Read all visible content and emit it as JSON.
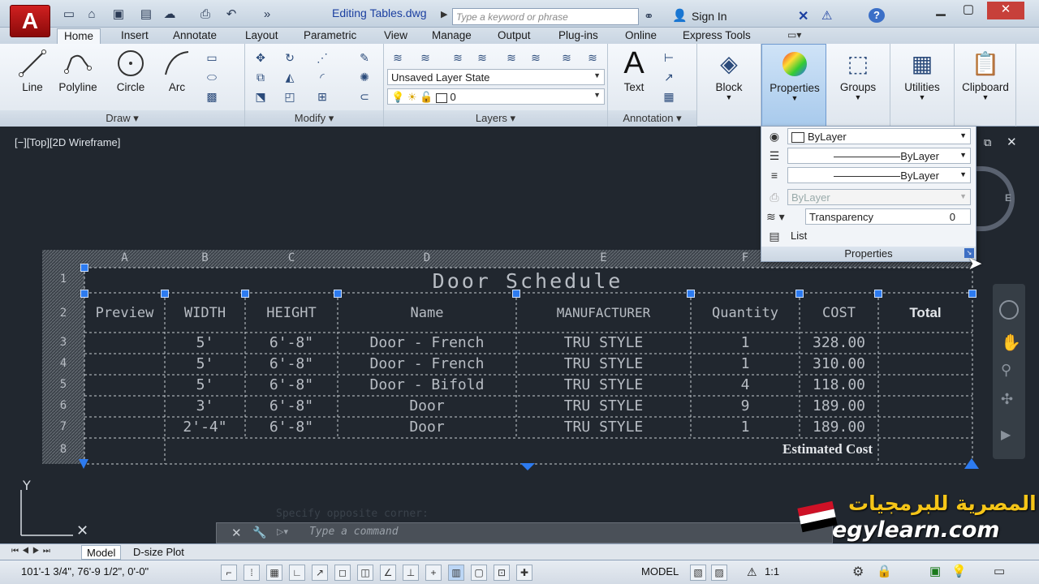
{
  "title_bar": {
    "app_logo": "A",
    "document_title": "Editing Tables.dwg",
    "search_placeholder": "Type a keyword or phrase",
    "sign_in": "Sign In",
    "help": "?"
  },
  "tabs": [
    "Home",
    "Insert",
    "Annotate",
    "Layout",
    "Parametric",
    "View",
    "Manage",
    "Output",
    "Plug-ins",
    "Online",
    "Express Tools"
  ],
  "active_tab": "Home",
  "ribbon": {
    "draw": {
      "title": "Draw",
      "tools": [
        "Line",
        "Polyline",
        "Circle",
        "Arc"
      ]
    },
    "modify": {
      "title": "Modify"
    },
    "layers": {
      "title": "Layers",
      "layer_state": "Unsaved Layer State",
      "current_layer": "0"
    },
    "annotation": {
      "title": "Annotation",
      "text": "Text"
    },
    "big_tools": [
      "Block",
      "Properties",
      "Groups",
      "Utilities",
      "Clipboard"
    ]
  },
  "properties_flyout": {
    "color": "ByLayer",
    "linetype": "ByLayer",
    "lineweight": "ByLayer",
    "plot_style": "ByLayer",
    "transparency_label": "Transparency",
    "transparency_value": "0",
    "list": "List",
    "title": "Properties"
  },
  "viewport_label": "[−][Top][2D Wireframe]",
  "table": {
    "column_letters": [
      "A",
      "B",
      "C",
      "D",
      "E",
      "F"
    ],
    "row_numbers": [
      "1",
      "2",
      "3",
      "4",
      "5",
      "6",
      "7",
      "8"
    ],
    "title": "Door Schedule",
    "headers": [
      "Preview",
      "WIDTH",
      "HEIGHT",
      "Name",
      "MANUFACTURER",
      "Quantity",
      "COST",
      "Total"
    ],
    "rows": [
      [
        "",
        "5'",
        "6'-8\"",
        "Door - French",
        "TRU STYLE",
        "1",
        "328.00",
        ""
      ],
      [
        "",
        "5'",
        "6'-8\"",
        "Door - French",
        "TRU STYLE",
        "1",
        "310.00",
        ""
      ],
      [
        "",
        "5'",
        "6'-8\"",
        "Door - Bifold",
        "TRU STYLE",
        "4",
        "118.00",
        ""
      ],
      [
        "",
        "3'",
        "6'-8\"",
        "Door",
        "TRU STYLE",
        "9",
        "189.00",
        ""
      ],
      [
        "",
        "2'-4\"",
        "6'-8\"",
        "Door",
        "TRU STYLE",
        "1",
        "189.00",
        ""
      ]
    ],
    "footer": "Estimated Cost"
  },
  "command_line": {
    "placeholder": "Type a command",
    "faded_history": "Specify opposite corner:"
  },
  "layout_tabs": [
    "Model",
    "D-size Plot"
  ],
  "status_bar": {
    "coordinates": "101'-1 3/4\", 76'-9 1/2\", 0'-0\"",
    "mode": "MODEL",
    "scale": "1:1"
  },
  "watermark": {
    "arabic": "المصرية للبرمجيات",
    "site": "egylearn.com"
  },
  "viewcube_label": "E",
  "colors": {
    "canvas": "#21272f",
    "grip": "#2d7bf0",
    "accent": "#1b3fa0"
  }
}
